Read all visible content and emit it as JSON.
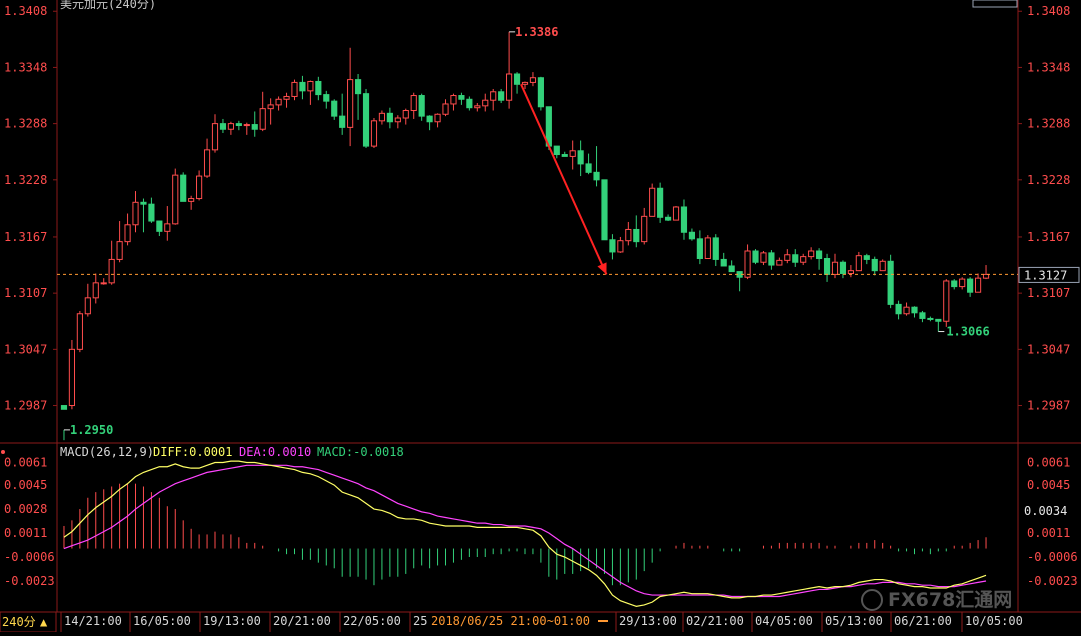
{
  "header": {
    "title": "美元加元(240分)"
  },
  "period_button": {
    "label": "240分",
    "arrow": "▲"
  },
  "price_axis": {
    "ticks": [
      "1.3408",
      "1.3348",
      "1.3288",
      "1.3228",
      "1.3167",
      "1.3107",
      "1.3047",
      "1.2987"
    ]
  },
  "price_marker": {
    "current": "1.3127",
    "high_label": "1.3386",
    "low_label": "1.2950",
    "recent_low_label": "1.3066"
  },
  "macd_header": {
    "name": "MACD(26,12,9)",
    "diff": "DIFF:0.0001",
    "dea": "DEA:0.0010",
    "macd": "MACD:-0.0018"
  },
  "macd_axis": {
    "ticks": [
      "0.0061",
      "0.0045",
      "0.0028",
      "0.0011",
      "-0.0006",
      "-0.0023"
    ],
    "right_marker": "0.0034"
  },
  "time_axis": {
    "labels": [
      "14/21:00",
      "16/05:00",
      "19/13:00",
      "20/21:00",
      "22/05:00",
      "25",
      "29/13:00",
      "02/21:00",
      "04/05:00",
      "05/13:00",
      "06/21:00",
      "10/05:00"
    ],
    "cursor_readout": "2018/06/25  21:00~01:00"
  },
  "watermark": {
    "text": "FX678汇通网"
  },
  "colors": {
    "up": "#ff4d4d",
    "down": "#33d17a",
    "grid": "#8b1a1a",
    "diff": "#ffff66",
    "dea": "#ff44ff",
    "accent": "#ff3333"
  },
  "chart_data": {
    "type": "candlestick",
    "title": "美元加元(240分)",
    "ylim": [
      2947,
      3420
    ],
    "price_scale": 10000,
    "ohlc": [
      [
        2987,
        2983,
        2961,
        2950
      ],
      [
        2987,
        3047,
        2983,
        3057
      ],
      [
        3047,
        3085,
        3044,
        3088
      ],
      [
        3085,
        3102,
        3082,
        3117
      ],
      [
        3102,
        3118,
        3096,
        3128
      ],
      [
        3118,
        3118,
        3116,
        3123
      ],
      [
        3118,
        3143,
        3116,
        3163
      ],
      [
        3143,
        3162,
        3140,
        3184
      ],
      [
        3162,
        3180,
        3158,
        3192
      ],
      [
        3180,
        3204,
        3172,
        3216
      ],
      [
        3204,
        3202,
        3172,
        3208
      ],
      [
        3202,
        3184,
        3182,
        3209
      ],
      [
        3184,
        3173,
        3168,
        3182
      ],
      [
        3173,
        3181,
        3163,
        3200
      ],
      [
        3181,
        3233,
        3180,
        3240
      ],
      [
        3233,
        3205,
        3205,
        3236
      ],
      [
        3205,
        3208,
        3196,
        3211
      ],
      [
        3208,
        3232,
        3206,
        3238
      ],
      [
        3232,
        3260,
        3230,
        3272
      ],
      [
        3260,
        3288,
        3257,
        3298
      ],
      [
        3288,
        3282,
        3278,
        3293
      ],
      [
        3282,
        3288,
        3276,
        3290
      ],
      [
        3288,
        3286,
        3281,
        3291
      ],
      [
        3286,
        3287,
        3276,
        3289
      ],
      [
        3287,
        3282,
        3274,
        3301
      ],
      [
        3282,
        3304,
        3280,
        3322
      ],
      [
        3304,
        3308,
        3287,
        3315
      ],
      [
        3308,
        3314,
        3302,
        3317
      ],
      [
        3314,
        3317,
        3305,
        3321
      ],
      [
        3317,
        3332,
        3313,
        3335
      ],
      [
        3332,
        3323,
        3314,
        3339
      ],
      [
        3323,
        3333,
        3308,
        3334
      ],
      [
        3333,
        3319,
        3313,
        3338
      ],
      [
        3319,
        3312,
        3304,
        3323
      ],
      [
        3312,
        3296,
        3292,
        3314
      ],
      [
        3296,
        3284,
        3276,
        3320
      ],
      [
        3284,
        3335,
        3264,
        3369
      ],
      [
        3335,
        3320,
        3292,
        3341
      ],
      [
        3320,
        3264,
        3262,
        3325
      ],
      [
        3264,
        3291,
        3262,
        3294
      ],
      [
        3291,
        3299,
        3287,
        3302
      ],
      [
        3299,
        3290,
        3283,
        3305
      ],
      [
        3290,
        3294,
        3283,
        3297
      ],
      [
        3294,
        3302,
        3287,
        3304
      ],
      [
        3302,
        3318,
        3293,
        3321
      ],
      [
        3318,
        3296,
        3291,
        3320
      ],
      [
        3296,
        3290,
        3281,
        3297
      ],
      [
        3290,
        3298,
        3284,
        3299
      ],
      [
        3298,
        3309,
        3296,
        3314
      ],
      [
        3309,
        3318,
        3302,
        3320
      ],
      [
        3318,
        3314,
        3308,
        3321
      ],
      [
        3314,
        3305,
        3302,
        3317
      ],
      [
        3305,
        3307,
        3301,
        3310
      ],
      [
        3307,
        3313,
        3301,
        3320
      ],
      [
        3313,
        3322,
        3302,
        3325
      ],
      [
        3322,
        3313,
        3310,
        3325
      ],
      [
        3313,
        3341,
        3304,
        3386
      ],
      [
        3341,
        3330,
        3320,
        3343
      ],
      [
        3330,
        3332,
        3325,
        3333
      ],
      [
        3332,
        3337,
        3328,
        3343
      ],
      [
        3337,
        3306,
        3302,
        3338
      ],
      [
        3306,
        3264,
        3260,
        3306
      ],
      [
        3264,
        3255,
        3251,
        3258
      ],
      [
        3255,
        3253,
        3254,
        3258
      ],
      [
        3253,
        3259,
        3239,
        3270
      ],
      [
        3259,
        3245,
        3232,
        3270
      ],
      [
        3245,
        3236,
        3234,
        3256
      ],
      [
        3236,
        3228,
        3221,
        3264
      ],
      [
        3228,
        3164,
        3164,
        3223
      ],
      [
        3164,
        3151,
        3143,
        3170
      ],
      [
        3151,
        3163,
        3150,
        3167
      ],
      [
        3163,
        3175,
        3158,
        3183
      ],
      [
        3175,
        3162,
        3156,
        3190
      ],
      [
        3162,
        3189,
        3159,
        3198
      ],
      [
        3189,
        3219,
        3189,
        3224
      ],
      [
        3219,
        3188,
        3182,
        3225
      ],
      [
        3188,
        3185,
        3184,
        3191
      ],
      [
        3185,
        3199,
        3185,
        3200
      ],
      [
        3199,
        3172,
        3164,
        3207
      ],
      [
        3172,
        3165,
        3163,
        3176
      ],
      [
        3165,
        3144,
        3138,
        3174
      ],
      [
        3144,
        3166,
        3145,
        3169
      ],
      [
        3166,
        3143,
        3136,
        3170
      ],
      [
        3143,
        3136,
        3137,
        3150
      ],
      [
        3136,
        3130,
        3130,
        3142
      ],
      [
        3130,
        3124,
        3109,
        3130
      ],
      [
        3124,
        3152,
        3122,
        3159
      ],
      [
        3152,
        3140,
        3138,
        3154
      ],
      [
        3140,
        3150,
        3137,
        3152
      ],
      [
        3150,
        3137,
        3132,
        3153
      ],
      [
        3137,
        3142,
        3137,
        3145
      ],
      [
        3142,
        3148,
        3139,
        3154
      ],
      [
        3148,
        3140,
        3135,
        3154
      ],
      [
        3140,
        3146,
        3137,
        3149
      ],
      [
        3146,
        3152,
        3143,
        3156
      ],
      [
        3152,
        3144,
        3132,
        3155
      ],
      [
        3144,
        3127,
        3119,
        3149
      ],
      [
        3127,
        3140,
        3123,
        3149
      ],
      [
        3140,
        3128,
        3123,
        3142
      ],
      [
        3128,
        3131,
        3124,
        3137
      ],
      [
        3131,
        3147,
        3132,
        3151
      ],
      [
        3147,
        3143,
        3138,
        3149
      ],
      [
        3143,
        3131,
        3126,
        3146
      ],
      [
        3131,
        3141,
        3131,
        3143
      ],
      [
        3141,
        3095,
        3091,
        3148
      ],
      [
        3095,
        3085,
        3079,
        3099
      ],
      [
        3085,
        3092,
        3083,
        3097
      ],
      [
        3092,
        3086,
        3081,
        3093
      ],
      [
        3086,
        3080,
        3076,
        3088
      ],
      [
        3080,
        3079,
        3077,
        3082
      ],
      [
        3079,
        3077,
        3066,
        3079
      ],
      [
        3077,
        3120,
        3071,
        3122
      ],
      [
        3120,
        3114,
        3111,
        3122
      ],
      [
        3114,
        3122,
        3111,
        3124
      ],
      [
        3122,
        3108,
        3103,
        3124
      ],
      [
        3108,
        3123,
        3108,
        3128
      ],
      [
        3123,
        3127,
        3122,
        3137
      ]
    ],
    "macd": {
      "ylim": [
        -0.0045,
        0.0072
      ],
      "diff": [
        0.0008,
        0.0012,
        0.0018,
        0.0024,
        0.0029,
        0.0033,
        0.0037,
        0.0042,
        0.0046,
        0.0051,
        0.0054,
        0.0056,
        0.0058,
        0.0058,
        0.006,
        0.0058,
        0.0057,
        0.0057,
        0.0059,
        0.0061,
        0.0061,
        0.0062,
        0.0062,
        0.0061,
        0.0061,
        0.006,
        0.0059,
        0.0058,
        0.0057,
        0.0056,
        0.0054,
        0.0053,
        0.0051,
        0.0048,
        0.0045,
        0.004,
        0.0038,
        0.0036,
        0.0032,
        0.0028,
        0.0027,
        0.0025,
        0.0022,
        0.0021,
        0.0021,
        0.002,
        0.0018,
        0.0017,
        0.0016,
        0.0016,
        0.0016,
        0.0016,
        0.0015,
        0.0015,
        0.0015,
        0.0015,
        0.0015,
        0.0015,
        0.0014,
        0.0013,
        0.0009,
        0.0001,
        -0.0004,
        -0.0006,
        -0.0009,
        -0.0012,
        -0.0015,
        -0.0019,
        -0.0025,
        -0.0033,
        -0.0037,
        -0.0039,
        -0.0041,
        -0.004,
        -0.0038,
        -0.0034,
        -0.0033,
        -0.0032,
        -0.0031,
        -0.0032,
        -0.0032,
        -0.0032,
        -0.0033,
        -0.0034,
        -0.0035,
        -0.0035,
        -0.0034,
        -0.0034,
        -0.0033,
        -0.0033,
        -0.0032,
        -0.0031,
        -0.003,
        -0.0029,
        -0.0028,
        -0.0027,
        -0.0028,
        -0.0027,
        -0.0027,
        -0.0026,
        -0.0024,
        -0.0023,
        -0.0022,
        -0.0022,
        -0.0023,
        -0.0025,
        -0.0026,
        -0.0027,
        -0.0027,
        -0.0028,
        -0.0028,
        -0.0028,
        -0.0026,
        -0.0025,
        -0.0023,
        -0.0021,
        -0.0019
      ],
      "dea": [
        0.0,
        0.0002,
        0.0004,
        0.0006,
        0.0009,
        0.0012,
        0.0015,
        0.0019,
        0.0023,
        0.0028,
        0.0032,
        0.0036,
        0.004,
        0.0043,
        0.0046,
        0.0048,
        0.005,
        0.0052,
        0.0054,
        0.0055,
        0.0056,
        0.0057,
        0.0058,
        0.0059,
        0.0059,
        0.0059,
        0.0059,
        0.0059,
        0.0059,
        0.0058,
        0.0058,
        0.0057,
        0.0056,
        0.0054,
        0.0052,
        0.005,
        0.0048,
        0.0046,
        0.0043,
        0.0041,
        0.0038,
        0.0035,
        0.0032,
        0.003,
        0.0028,
        0.0026,
        0.0025,
        0.0023,
        0.0022,
        0.0021,
        0.002,
        0.0019,
        0.0018,
        0.0018,
        0.0017,
        0.0017,
        0.0016,
        0.0016,
        0.0016,
        0.0015,
        0.0014,
        0.0011,
        0.0007,
        0.0003,
        0.0,
        -0.0004,
        -0.0008,
        -0.0012,
        -0.0016,
        -0.002,
        -0.0024,
        -0.0027,
        -0.003,
        -0.0032,
        -0.0033,
        -0.0033,
        -0.0033,
        -0.0033,
        -0.0033,
        -0.0033,
        -0.0033,
        -0.0033,
        -0.0033,
        -0.0033,
        -0.0034,
        -0.0034,
        -0.0034,
        -0.0034,
        -0.0034,
        -0.0034,
        -0.0034,
        -0.0033,
        -0.0032,
        -0.0031,
        -0.003,
        -0.0029,
        -0.0029,
        -0.0028,
        -0.0027,
        -0.0027,
        -0.0026,
        -0.0025,
        -0.0025,
        -0.0024,
        -0.0024,
        -0.0024,
        -0.0025,
        -0.0025,
        -0.0026,
        -0.0026,
        -0.0027,
        -0.0027,
        -0.0027,
        -0.0026,
        -0.0025,
        -0.0024,
        -0.0023
      ]
    }
  }
}
